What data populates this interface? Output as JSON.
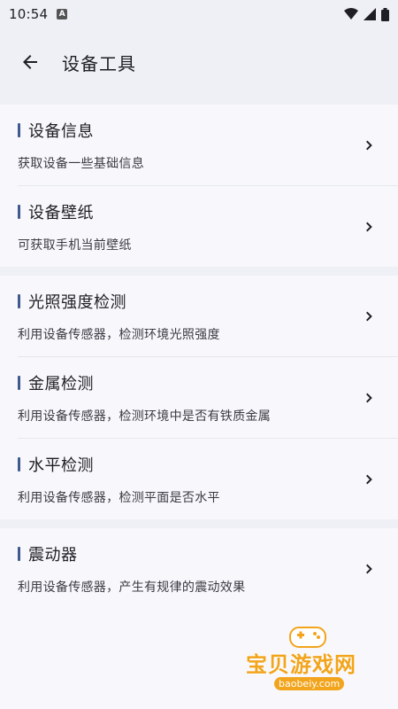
{
  "status_bar": {
    "time": "10:54",
    "notification_icon": "a-badge-icon",
    "icons": [
      "wifi-icon",
      "signal-icon",
      "battery-icon"
    ]
  },
  "app_bar": {
    "back_icon": "arrow-back-icon",
    "title": "设备工具"
  },
  "sections": [
    {
      "items": [
        {
          "title": "设备信息",
          "subtitle": "获取设备一些基础信息"
        },
        {
          "title": "设备壁纸",
          "subtitle": "可获取手机当前壁纸"
        }
      ]
    },
    {
      "items": [
        {
          "title": "光照强度检测",
          "subtitle": "利用设备传感器，检测环境光照强度"
        },
        {
          "title": "金属检测",
          "subtitle": "利用设备传感器，检测环境中是否有铁质金属"
        },
        {
          "title": "水平检测",
          "subtitle": "利用设备传感器，检测平面是否水平"
        }
      ]
    },
    {
      "items": [
        {
          "title": "震动器",
          "subtitle": "利用设备传感器，产生有规律的震动效果"
        }
      ]
    }
  ],
  "watermark": {
    "title": "宝贝游戏网",
    "url": "baobeiy.com"
  },
  "colors": {
    "accent": "#3f5a8f",
    "background": "#f8f8fc",
    "header": "#eef0f5",
    "watermark": "#f2a41c"
  }
}
